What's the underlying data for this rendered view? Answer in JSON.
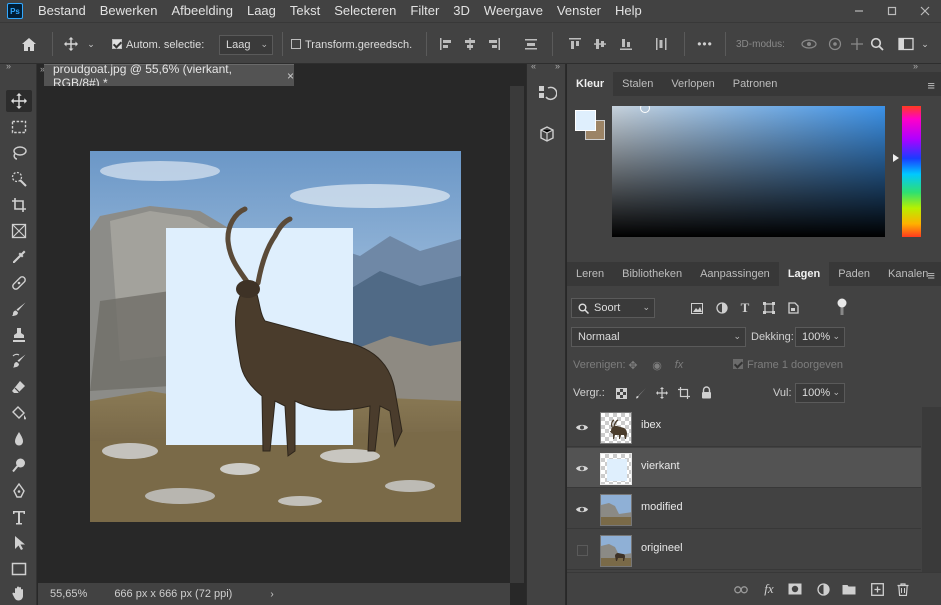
{
  "menubar": {
    "logo": "Ps",
    "items": [
      "Bestand",
      "Bewerken",
      "Afbeelding",
      "Laag",
      "Tekst",
      "Selecteren",
      "Filter",
      "3D",
      "Weergave",
      "Venster",
      "Help"
    ]
  },
  "options": {
    "auto_select_label": "Autom. selectie:",
    "auto_select_checked": true,
    "target_value": "Laag",
    "transform_label": "Transform.gereedsch.",
    "transform_checked": false,
    "more_label": "•••",
    "mode_3d_label": "3D-modus:"
  },
  "document": {
    "tab_title": "proudgoat.jpg @ 55,6% (vierkant, RGB/8#) *",
    "close_symbol": "×",
    "zoom": "55,65%",
    "doc_info": "666 px x 666 px (72 ppi)"
  },
  "color_panel": {
    "tabs": [
      "Kleur",
      "Stalen",
      "Verlopen",
      "Patronen"
    ],
    "active_tab": "Kleur",
    "foreground_color": "#dfeffd",
    "background_color": "#9c8466"
  },
  "layers_panel": {
    "tabs": [
      "Leren",
      "Bibliotheken",
      "Aanpassingen",
      "Lagen",
      "Paden",
      "Kanalen"
    ],
    "active_tab": "Lagen",
    "filter_kind": "Soort",
    "blend_mode": "Normaal",
    "opacity_label": "Dekking:",
    "opacity_value": "100%",
    "unify_label": "Verenigen:",
    "propagate_label": "Frame 1 doorgeven",
    "lock_label": "Vergr.:",
    "fill_label": "Vul:",
    "fill_value": "100%",
    "layers": [
      {
        "name": "ibex",
        "visible": true,
        "selected": false
      },
      {
        "name": "vierkant",
        "visible": true,
        "selected": true
      },
      {
        "name": "modified",
        "visible": true,
        "selected": false
      },
      {
        "name": "origineel",
        "visible": false,
        "selected": false
      }
    ]
  },
  "colors": {
    "accent": "#31a8ff",
    "panel": "#424242",
    "square_fill": "#dfeffd"
  }
}
